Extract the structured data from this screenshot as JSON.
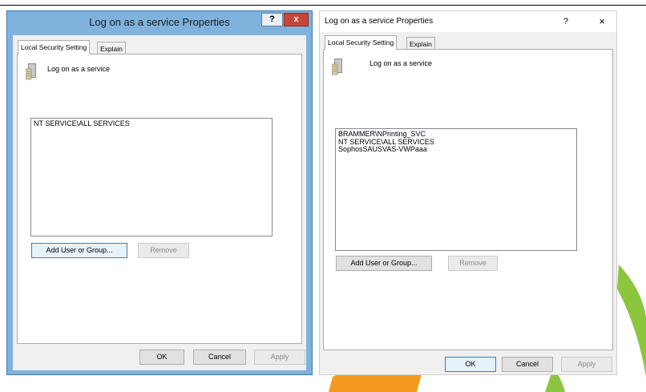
{
  "left_dialog": {
    "title": "Log on as a service Properties",
    "help_glyph": "?",
    "close_glyph": "x",
    "tabs": [
      "Local Security Setting",
      "Explain"
    ],
    "policy_name": "Log on as a service",
    "list_items": [
      "NT SERVICE\\ALL SERVICES"
    ],
    "add_button": "Add User or Group...",
    "remove_button": "Remove",
    "ok_button": "OK",
    "cancel_button": "Cancel",
    "apply_button": "Apply",
    "icon": "server-policy-icon"
  },
  "right_dialog": {
    "title": "Log on as a service Properties",
    "help_glyph": "?",
    "close_glyph": "×",
    "tabs": [
      "Local Security Setting",
      "Explain"
    ],
    "policy_name": "Log on as a service",
    "list_items": [
      "BRAMMER\\NPrinting_SVC",
      "NT SERVICE\\ALL SERVICES",
      "SophosSAUSVAS-VWPaaa"
    ],
    "add_button": "Add User or Group...",
    "remove_button": "Remove",
    "ok_button": "OK",
    "cancel_button": "Cancel",
    "apply_button": "Apply",
    "icon": "server-policy-icon"
  },
  "colors": {
    "win8_frame": "#7fb2dc",
    "close_red": "#c7463a",
    "deco_orange": "#f39a1e",
    "deco_green": "#8cc63f"
  }
}
